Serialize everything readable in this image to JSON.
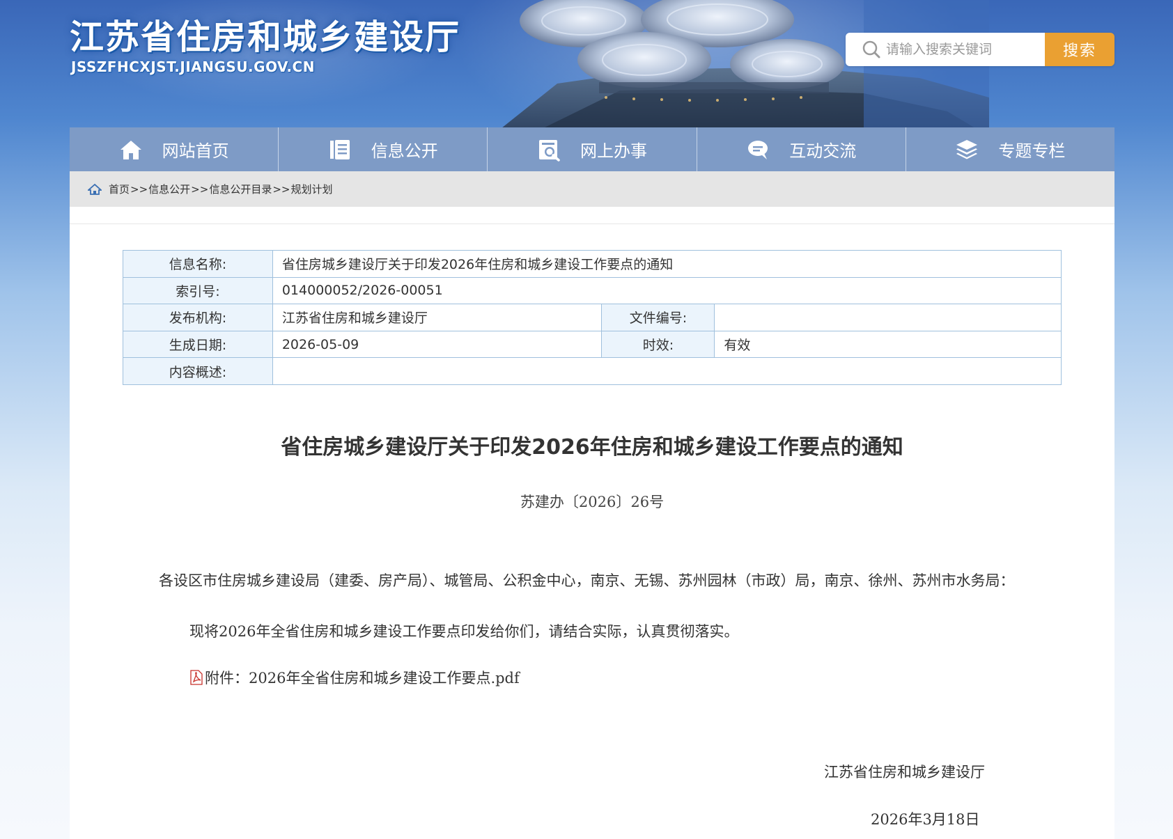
{
  "header": {
    "site_title": "江苏省住房和城乡建设厅",
    "site_domain": "JSSZFHCXJST.JIANGSU.GOV.CN",
    "search_placeholder": "请输入搜索关键词",
    "search_button": "搜索"
  },
  "nav": {
    "items": [
      {
        "label": "网站首页",
        "icon": "home-icon"
      },
      {
        "label": "信息公开",
        "icon": "document-icon"
      },
      {
        "label": "网上办事",
        "icon": "service-search-icon"
      },
      {
        "label": "互动交流",
        "icon": "chat-bubble-icon"
      },
      {
        "label": "专题专栏",
        "icon": "layers-icon"
      }
    ]
  },
  "breadcrumb": {
    "items": [
      "首页",
      "信息公开",
      "信息公开目录",
      "规划计划"
    ],
    "separator": ">>"
  },
  "info_table": {
    "name_label": "信息名称:",
    "name_value": "省住房城乡建设厅关于印发2026年住房和城乡建设工作要点的通知",
    "index_label": "索引号:",
    "index_value": "014000052/2026-00051",
    "publisher_label": "发布机构:",
    "publisher_value": "江苏省住房和城乡建设厅",
    "doc_no_label": "文件编号:",
    "doc_no_value": "",
    "date_label": "生成日期:",
    "date_value": "2026-05-09",
    "validity_label": "时效:",
    "validity_value": "有效",
    "summary_label": "内容概述:",
    "summary_value": ""
  },
  "document": {
    "title": "省住房城乡建设厅关于印发2026年住房和城乡建设工作要点的通知",
    "number": "苏建办〔2026〕26号",
    "recipients": "各设区市住房城乡建设局（建委、房产局）、城管局、公积金中心，南京、无锡、苏州园林（市政）局，南京、徐州、苏州市水务局：",
    "body": "现将2026年全省住房和城乡建设工作要点印发给你们，请结合实际，认真贯彻落实。",
    "attachment": "附件：2026年全省住房和城乡建设工作要点.pdf",
    "signature": "江苏省住房和城乡建设厅",
    "sign_date": "2026年3月18日"
  },
  "colors": {
    "nav_bg": "#7e9bc6",
    "search_button": "#eaa032",
    "table_border": "#9fc0dd",
    "table_label_bg": "#ebf4fc",
    "breadcrumb_bg": "#e5e5e5"
  }
}
